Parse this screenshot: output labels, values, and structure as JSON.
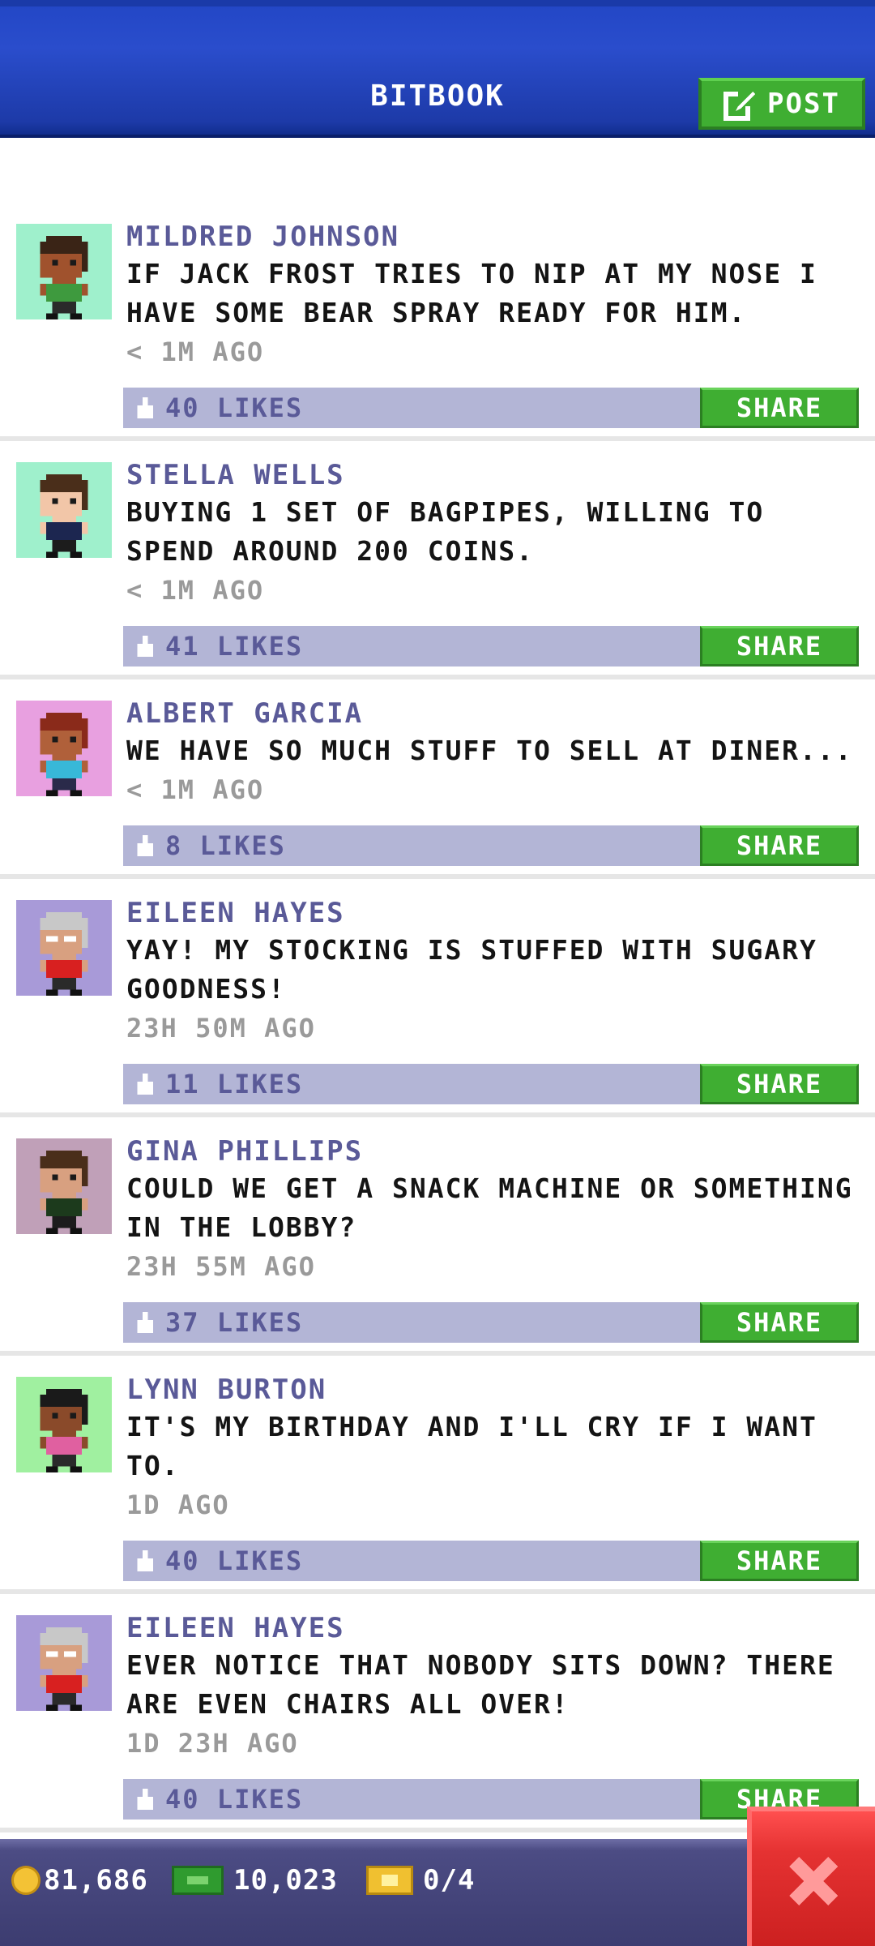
{
  "header": {
    "title": "BITBOOK",
    "post_label": "POST"
  },
  "posts": [
    {
      "author": "MILDRED JOHNSON",
      "message": "IF JACK FROST TRIES TO NIP AT MY NOSE I HAVE SOME BEAR SPRAY READY FOR HIM.",
      "time": "< 1M AGO",
      "likes": "40 LIKES",
      "share_label": "SHARE",
      "avatar": {
        "bg": "#9ff0cc",
        "skin": "#a0522d",
        "hair": "#3a2416",
        "shirt": "#3e9a3e",
        "pants": "#2a2a2a",
        "glasses": false
      }
    },
    {
      "author": "STELLA WELLS",
      "message": "BUYING 1 SET OF BAGPIPES, WILLING TO SPEND AROUND 200 COINS.",
      "time": "< 1M AGO",
      "likes": "41 LIKES",
      "share_label": "SHARE",
      "avatar": {
        "bg": "#9ff0cc",
        "skin": "#f2c6a8",
        "hair": "#4a2e1a",
        "shirt": "#1c2650",
        "pants": "#1c1c1c",
        "glasses": false
      }
    },
    {
      "author": "ALBERT GARCIA",
      "message": "WE HAVE SO MUCH STUFF TO SELL AT DINER...",
      "time": "< 1M AGO",
      "likes": "8 LIKES",
      "share_label": "SHARE",
      "avatar": {
        "bg": "#e8a0e0",
        "skin": "#b0603a",
        "hair": "#8a2a1a",
        "shirt": "#38b8d8",
        "pants": "#2a2a4a",
        "glasses": false
      }
    },
    {
      "author": "EILEEN HAYES",
      "message": "YAY! MY STOCKING IS STUFFED WITH SUGARY GOODNESS!",
      "time": "23H 50M AGO",
      "likes": "11 LIKES",
      "share_label": "SHARE",
      "avatar": {
        "bg": "#a89ad8",
        "skin": "#d8a080",
        "hair": "#c8c8c8",
        "shirt": "#d82020",
        "pants": "#2a2a2a",
        "glasses": true
      }
    },
    {
      "author": "GINA PHILLIPS",
      "message": "COULD WE GET A SNACK MACHINE OR SOMETHING IN THE LOBBY?",
      "time": "23H 55M AGO",
      "likes": "37 LIKES",
      "share_label": "SHARE",
      "avatar": {
        "bg": "#c0a0b8",
        "skin": "#d8a080",
        "hair": "#4a2e1a",
        "shirt": "#1c3a1c",
        "pants": "#1c1c1c",
        "glasses": false
      }
    },
    {
      "author": "LYNN BURTON",
      "message": "IT'S MY BIRTHDAY AND I'LL CRY IF I WANT TO.",
      "time": "1D AGO",
      "likes": "40 LIKES",
      "share_label": "SHARE",
      "avatar": {
        "bg": "#a0f0a0",
        "skin": "#8a4a2a",
        "hair": "#1a1a1a",
        "shirt": "#e060a0",
        "pants": "#2a2a2a",
        "glasses": false
      }
    },
    {
      "author": "EILEEN HAYES",
      "message": "EVER NOTICE THAT NOBODY SITS DOWN? THERE ARE EVEN CHAIRS ALL OVER!",
      "time": "1D 23H AGO",
      "likes": "40 LIKES",
      "share_label": "SHARE",
      "avatar": {
        "bg": "#a89ad8",
        "skin": "#d8a080",
        "hair": "#c8c8c8",
        "shirt": "#d82020",
        "pants": "#2a2a2a",
        "glasses": true
      }
    }
  ],
  "footer": {
    "coins": "81,686",
    "bux": "10,023",
    "tickets": "0/4"
  },
  "colors": {
    "header_blue": "#2347c6",
    "share_green": "#3fae32",
    "likes_bar": "#b3b5d6",
    "author_purple": "#5a5a98",
    "close_red": "#e53232"
  },
  "icons": {
    "post": "edit-icon",
    "like": "thumb-icon",
    "coin": "coin-icon",
    "bux": "bux-icon",
    "ticket": "ticket-icon",
    "close": "close-icon"
  }
}
